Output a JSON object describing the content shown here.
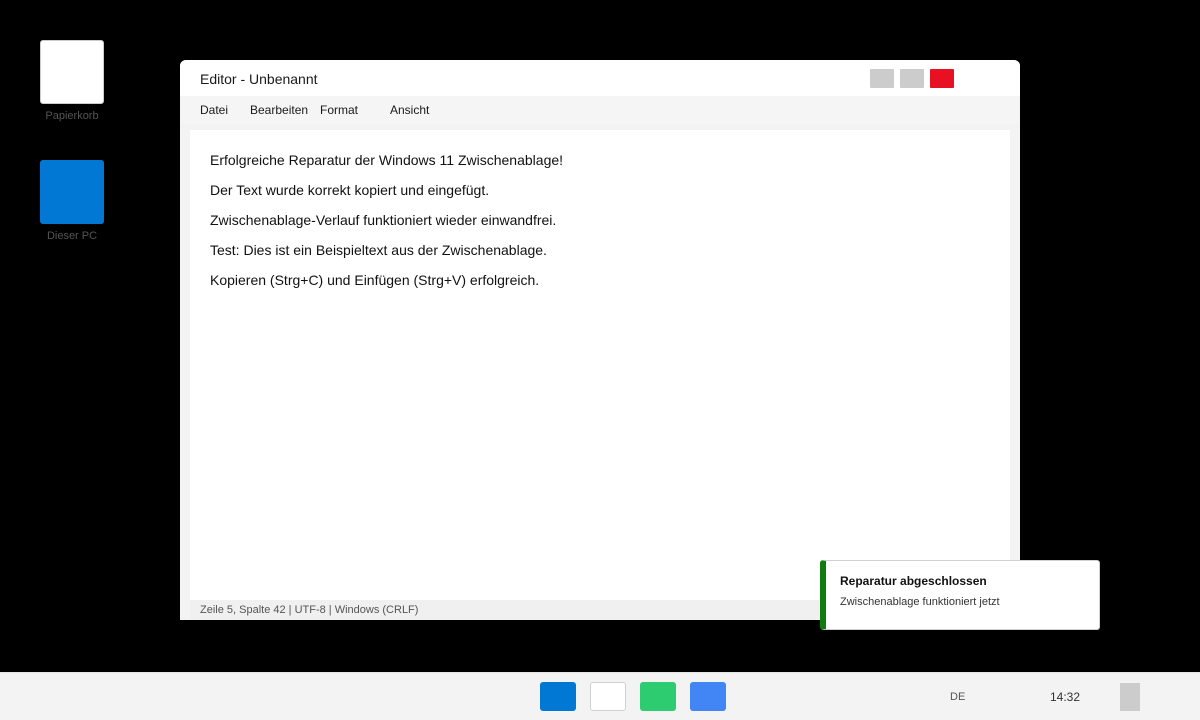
{
  "desktop": {
    "icons": [
      {
        "label": "Papierkorb",
        "icon": "recycle-bin-icon"
      },
      {
        "label": "Dieser PC",
        "icon": "this-pc-icon"
      }
    ]
  },
  "window": {
    "title": "Editor - Unbenannt",
    "controls": {
      "minimize": "minimize-icon",
      "maximize": "maximize-icon",
      "close": "close-icon",
      "close_color": "#e81123"
    },
    "menu": [
      "Datei",
      "Bearbeiten",
      "Format",
      "Ansicht"
    ],
    "content_lines": [
      "Erfolgreiche Reparatur der Windows 11 Zwischenablage!",
      "Der Text wurde korrekt kopiert und eingefügt.",
      "Zwischenablage-Verlauf funktioniert wieder einwandfrei.",
      "Test: Dies ist ein Beispieltext aus der Zwischenablage.",
      "Kopieren (Strg+C) und Einfügen (Strg+V) erfolgreich."
    ],
    "status": "Zeile 5, Spalte 42 | UTF-8 | Windows (CRLF)"
  },
  "notification": {
    "title": "Reparatur abgeschlossen",
    "message": "Zwischenablage funktioniert jetzt",
    "accent": "#107c10"
  },
  "taskbar": {
    "apps": [
      {
        "icon": "start-icon",
        "color": "#0078d4"
      },
      {
        "icon": "file-explorer-icon",
        "color": "#ffffff"
      },
      {
        "icon": "app-green-icon",
        "color": "#2ecc71"
      },
      {
        "icon": "browser-icon",
        "color": "#4285f4"
      }
    ],
    "language": "DE",
    "clock": "14:32"
  }
}
